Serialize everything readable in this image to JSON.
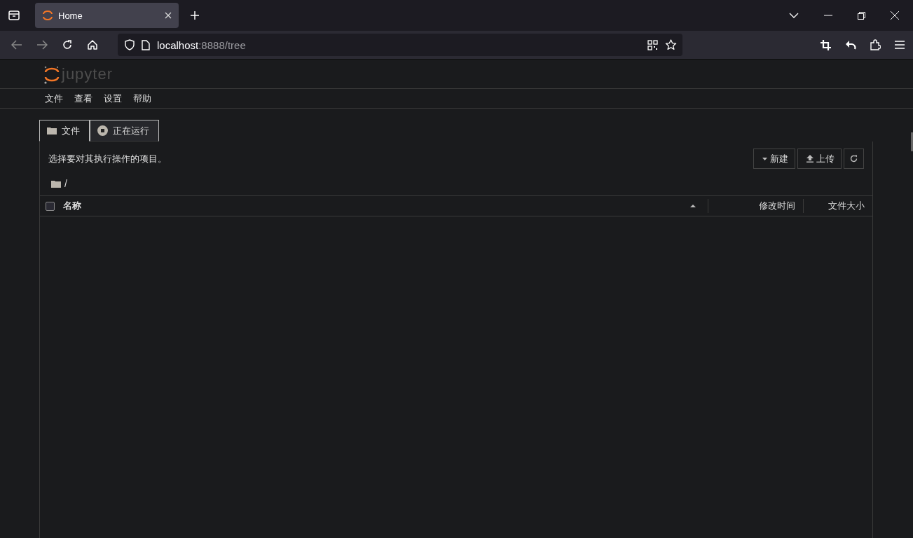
{
  "browser_tabs": [
    {
      "title": "Home",
      "selected": true
    }
  ],
  "address": {
    "host": "localhost",
    "rest": ":8888/tree"
  },
  "logo": {
    "text": "jupyter"
  },
  "menu": [
    "文件",
    "查看",
    "设置",
    "帮助"
  ],
  "tabs": [
    {
      "label": "文件",
      "kind": "files",
      "selected": true
    },
    {
      "label": "正在运行",
      "kind": "running",
      "selected": false
    }
  ],
  "hint": "选择要对其执行操作的项目。",
  "buttons": [
    {
      "kind": "new",
      "label": "新建"
    },
    {
      "kind": "upload",
      "label": "上传"
    },
    {
      "kind": "refresh"
    }
  ],
  "breadcrumb": "/",
  "columns": [
    {
      "label": "名称"
    },
    {
      "label": "修改时间"
    },
    {
      "label": "文件大小"
    }
  ],
  "select_all": {
    "checked": false
  }
}
